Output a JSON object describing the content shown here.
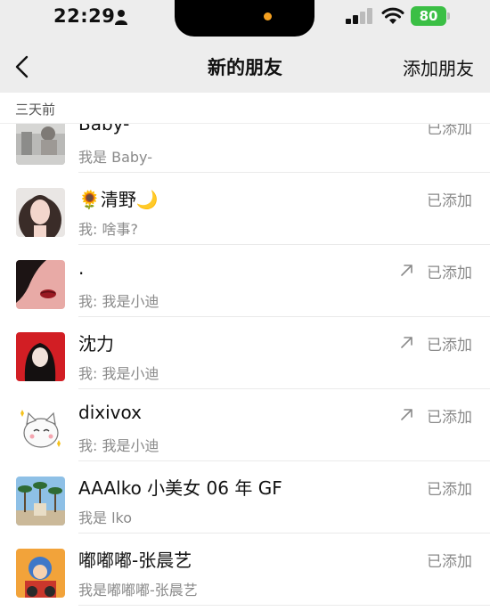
{
  "status_bar": {
    "time": "22:29",
    "battery": "80"
  },
  "nav": {
    "title": "新的朋友",
    "action": "添加朋友"
  },
  "section": {
    "header": "三天前"
  },
  "colors": {
    "background": "#ededed",
    "battery": "#3bbf45",
    "island_dot": "#f5a020",
    "secondary_text": "#8a8a8a"
  },
  "friends": [
    {
      "name": "Baby-",
      "note": "我是 Baby-",
      "status": "已添加"
    },
    {
      "name": "🌻清野🌙",
      "note": "我: 啥事?",
      "status": "已添加"
    },
    {
      "name": ".",
      "note": "我: 我是小迪",
      "status": "已添加"
    },
    {
      "name": "沈力",
      "note": "我: 我是小迪",
      "status": "已添加"
    },
    {
      "name": "dixivox",
      "note": "我: 我是小迪",
      "status": "已添加"
    },
    {
      "name": "AAAlko 小美女 06 年 GF",
      "note": "我是 lko",
      "status": "已添加"
    },
    {
      "name": "嘟嘟嘟-张晨艺",
      "note": "我是嘟嘟嘟-张晨艺",
      "status": "已添加"
    }
  ]
}
